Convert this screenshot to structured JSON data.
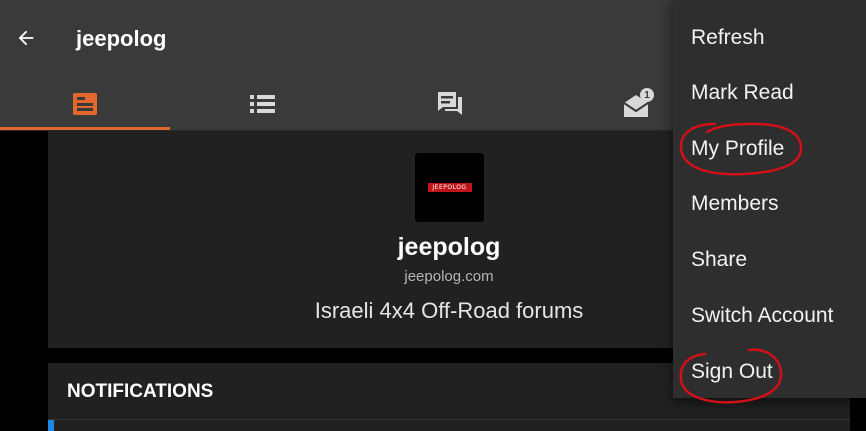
{
  "appbar": {
    "back_icon": "arrow-left-icon",
    "title": "jeepolog"
  },
  "tabs": [
    {
      "icon": "feed-icon",
      "selected": true
    },
    {
      "icon": "list-icon",
      "selected": false
    },
    {
      "icon": "chat-icon",
      "selected": false
    },
    {
      "icon": "mail-icon",
      "selected": false,
      "badge": "1"
    }
  ],
  "profile": {
    "logo_text": "JEEPOLOG",
    "name": "jeepolog",
    "domain": "jeepolog.com",
    "description": "Israeli 4x4 Off-Road forums"
  },
  "notifications": {
    "title": "NOTIFICATIONS"
  },
  "menu": {
    "items": [
      {
        "label": "Refresh"
      },
      {
        "label": "Mark Read"
      },
      {
        "label": "My Profile",
        "circled": true
      },
      {
        "label": "Members"
      },
      {
        "label": "Share"
      },
      {
        "label": "Switch Account"
      },
      {
        "label": "Sign Out",
        "circled": true
      }
    ]
  },
  "colors": {
    "accent": "#e2672e",
    "appbar": "#3a3a3a",
    "card": "#212121",
    "menu": "#2e2e2e",
    "annotation": "#d0101a",
    "notification_accent": "#1e88e5"
  }
}
